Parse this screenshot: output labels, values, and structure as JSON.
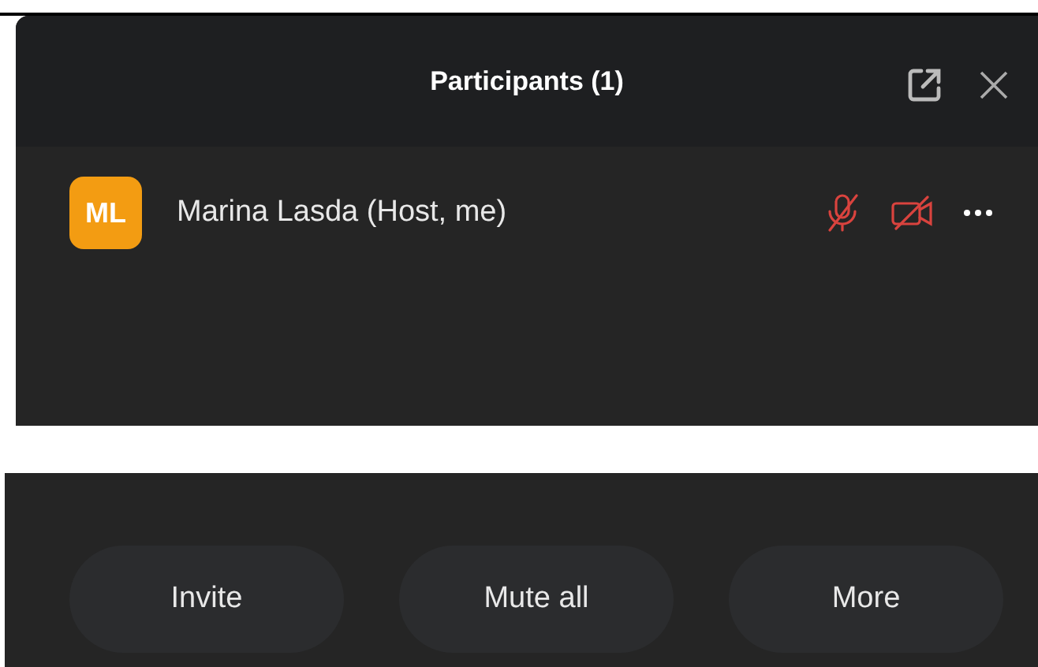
{
  "panel": {
    "title": "Participants (1)"
  },
  "participants": [
    {
      "initials": "ML",
      "name": "Marina Lasda (Host, me)",
      "mic_muted": true,
      "camera_off": true
    }
  ],
  "buttons": [
    "Invite",
    "Mute all",
    "More"
  ]
}
